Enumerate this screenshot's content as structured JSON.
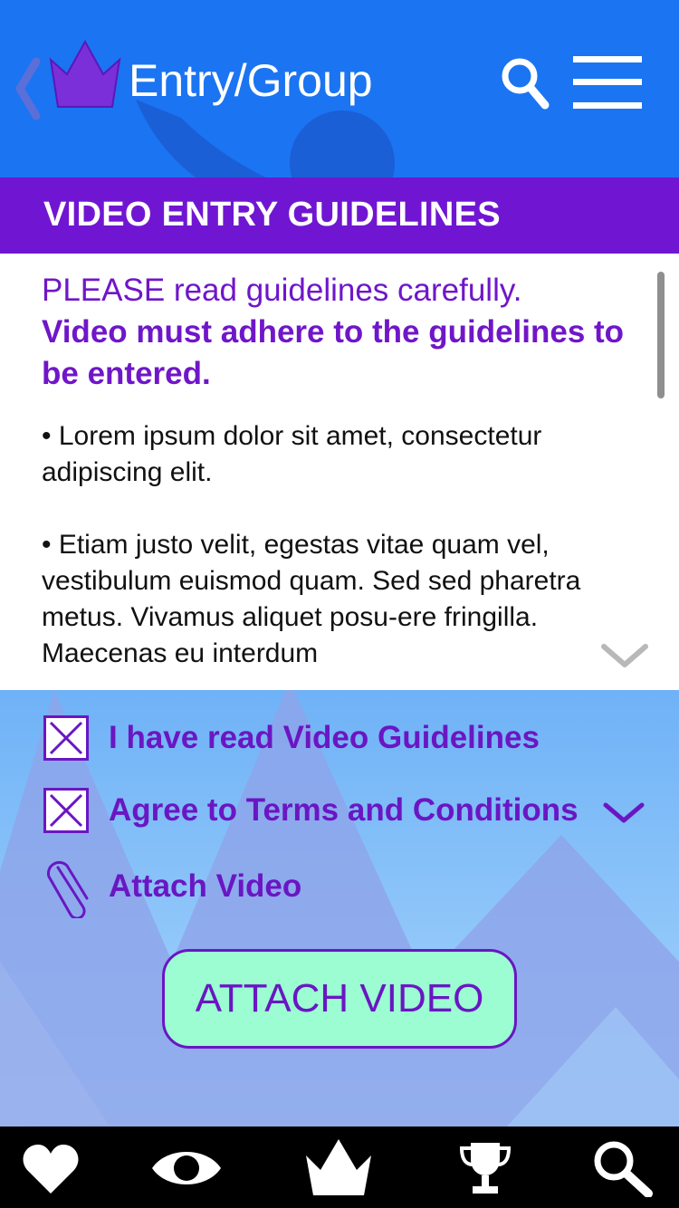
{
  "header": {
    "title": "Entry/Group",
    "back_icon": "chevron-left-icon",
    "logo_icon": "brand-crown-logo",
    "search_icon": "search-icon",
    "menu_icon": "hamburger-menu-icon",
    "background_color": "#1b74f2"
  },
  "section": {
    "title": "VIDEO ENTRY GUIDELINES",
    "background_color": "#7016d2"
  },
  "guidelines": {
    "intro_regular": "PLEASE read guidelines carefully.",
    "intro_bold": "Video must adhere to the guidelines to be entered.",
    "paragraphs": [
      "• Lorem ipsum dolor sit amet, consectetur adipiscing elit.",
      "• Etiam justo velit, egestas vitae quam vel, vestibulum euismod quam. Sed sed pharetra metus. Vivamus aliquet posu-ere fringilla. Maecenas eu interdum"
    ],
    "scroll_icon": "chevron-down-icon",
    "accent_color": "#7016c9"
  },
  "checklist": {
    "read_guidelines": {
      "label": "I have read Video Guidelines",
      "checked": true
    },
    "agree_terms": {
      "label": "Agree to Terms and Conditions",
      "checked": true
    },
    "attach": {
      "label": "Attach Video",
      "icon": "paperclip-icon"
    }
  },
  "attach_button": {
    "label": "ATTACH VIDEO",
    "background_color": "#9bfdd1"
  },
  "bottom_nav": {
    "items": [
      "heart-icon",
      "eye-icon",
      "brand-logo-icon",
      "trophy-icon",
      "search-icon"
    ]
  }
}
